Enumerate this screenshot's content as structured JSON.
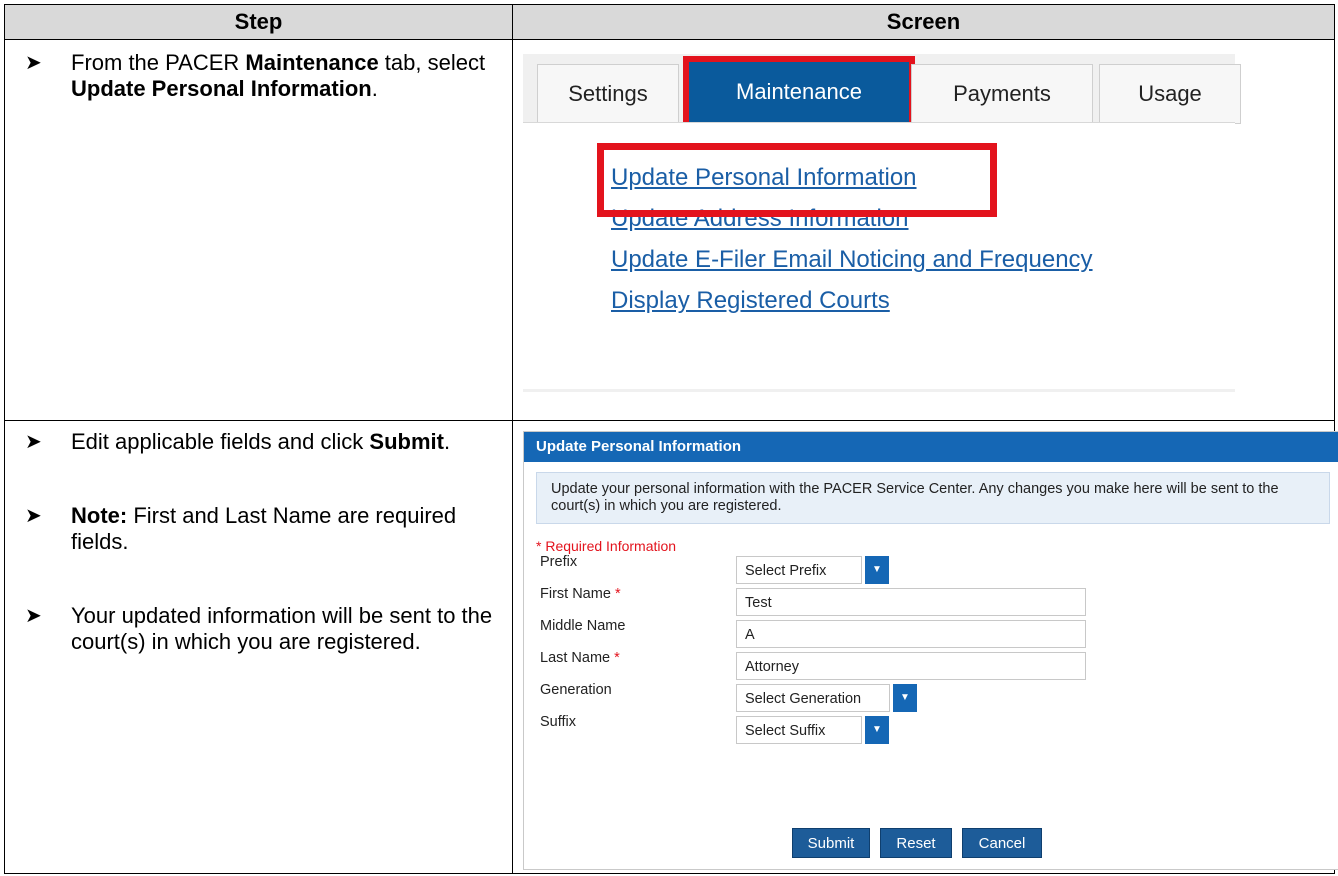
{
  "table": {
    "header_step": "Step",
    "header_screen": "Screen"
  },
  "row1": {
    "instruction": {
      "prefix": "From the PACER ",
      "bold1": "Maintenance",
      "middle": " tab, select ",
      "bold2": "Update Personal Information",
      "suffix": "."
    },
    "tabs": [
      "Settings",
      "Maintenance",
      "Payments",
      "Usage"
    ],
    "active_tab": "Maintenance",
    "links": [
      "Update Personal Information",
      "Update Address Information",
      "Update E-Filer Email Noticing and Frequency",
      "Display Registered Courts"
    ]
  },
  "row2": {
    "bullets": [
      {
        "prefix": "Edit applicable fields and click ",
        "bold": "Submit",
        "suffix": "."
      },
      {
        "bold": "Note:",
        "suffix": " First and Last Name are required fields."
      },
      {
        "text": "Your updated information will be sent to the court(s) in which you are registered."
      }
    ],
    "form": {
      "title": "Update Personal Information",
      "notice": "Update your personal information with the PACER Service Center. Any changes you make here will be sent to the court(s) in which you are registered.",
      "required_note": "* Required Information",
      "required_star": "*",
      "fields": {
        "prefix": {
          "label": "Prefix",
          "value": "Select Prefix"
        },
        "first_name": {
          "label": "First Name",
          "value": "Test"
        },
        "middle_name": {
          "label": "Middle Name",
          "value": "A"
        },
        "last_name": {
          "label": "Last Name",
          "value": "Attorney"
        },
        "generation": {
          "label": "Generation",
          "value": "Select Generation"
        },
        "suffix": {
          "label": "Suffix",
          "value": "Select Suffix"
        }
      },
      "buttons": {
        "submit": "Submit",
        "reset": "Reset",
        "cancel": "Cancel"
      }
    }
  },
  "icons": {
    "bullet": "arrow-bullet-icon",
    "dropdown": "chevron-down-icon"
  },
  "colors": {
    "highlight_red": "#e3131d",
    "tab_active": "#0a5a9c",
    "link_blue": "#1a5ea6",
    "form_header": "#1567b5"
  }
}
